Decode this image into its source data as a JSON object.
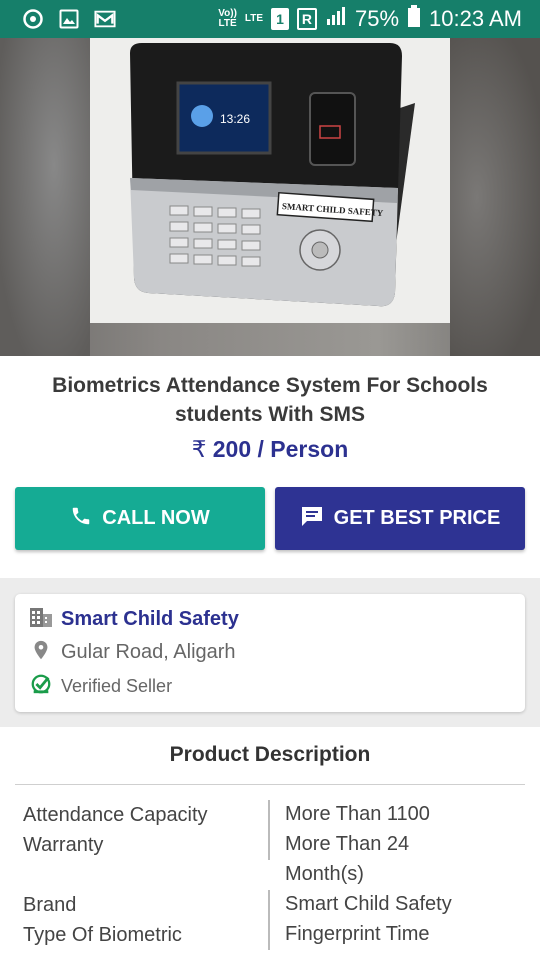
{
  "status_bar": {
    "network_top": "Vo))",
    "network_bottom": "LTE",
    "lte_label": "LTE",
    "sim1": "1",
    "sim_r": "R",
    "battery": "75%",
    "time": "10:23 AM"
  },
  "product": {
    "title": "Biometrics Attendance System For Schools students With SMS",
    "currency_symbol": "₹",
    "price": "200 / Person",
    "device_screen_time": "13:26",
    "device_brand_sticker": "SMART CHILD SAFETY"
  },
  "actions": {
    "call_label": "CALL NOW",
    "best_price_label": "GET BEST PRICE"
  },
  "seller": {
    "name": "Smart Child Safety",
    "location": "Gular Road, Aligarh",
    "badge": "Verified Seller"
  },
  "description": {
    "heading": "Product Description",
    "specs": [
      {
        "label": "Attendance Capacity",
        "value": "More Than 1100"
      },
      {
        "label": "Warranty",
        "value": "More Than 24 Month(s)"
      },
      {
        "label": "Brand",
        "value": "Smart Child Safety"
      },
      {
        "label": "Type Of Biometric",
        "value": "Fingerprint Time"
      }
    ]
  },
  "colors": {
    "status_bar": "#167f6a",
    "call_button": "#15ab94",
    "price_button": "#2e3393",
    "accent_text": "#2c3190",
    "verified": "#1a9c4a"
  }
}
